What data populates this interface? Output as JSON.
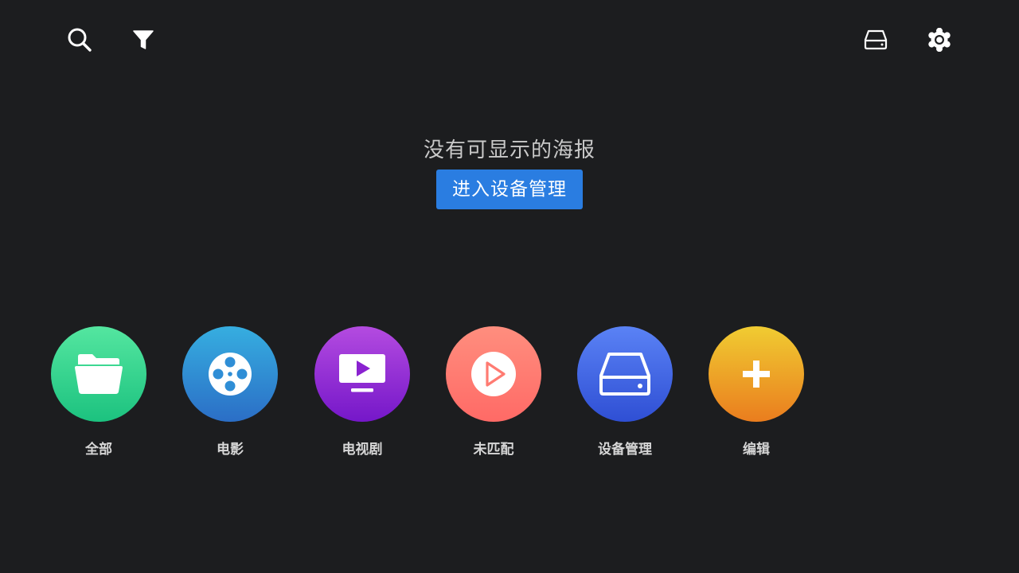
{
  "toolbar": {
    "left_icons": [
      "search-icon",
      "filter-icon"
    ],
    "right_icons": [
      "storage-icon",
      "settings-icon"
    ]
  },
  "empty_state": {
    "message": "没有可显示的海报",
    "button_label": "进入设备管理"
  },
  "categories": [
    {
      "label": "全部",
      "icon": "folder-icon",
      "colors": [
        "#54e6a0",
        "#1cc27f"
      ]
    },
    {
      "label": "电影",
      "icon": "film-reel-icon",
      "colors": [
        "#36aee0",
        "#2b6ec6"
      ]
    },
    {
      "label": "电视剧",
      "icon": "tv-play-icon",
      "colors": [
        "#b44be0",
        "#7517c9"
      ]
    },
    {
      "label": "未匹配",
      "icon": "play-circle-icon",
      "colors": [
        "#ff8e7e",
        "#ff6a66"
      ]
    },
    {
      "label": "设备管理",
      "icon": "hard-drive-icon",
      "colors": [
        "#5a82f5",
        "#2f4fd4"
      ]
    },
    {
      "label": "编辑",
      "icon": "plus-icon",
      "colors": [
        "#f0cc32",
        "#ea7d1e"
      ]
    }
  ],
  "colors": {
    "background": "#1c1d1f",
    "accent_button": "#2a7de1",
    "message_text": "#c9c9c9",
    "label_text": "#d6d6d6"
  }
}
